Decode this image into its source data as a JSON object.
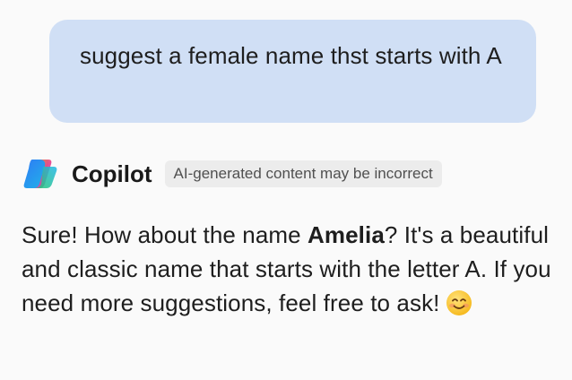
{
  "user_message": {
    "text": "suggest a female name thst starts with A"
  },
  "assistant": {
    "name": "Copilot",
    "disclaimer": "AI-generated content may be incorrect",
    "reply": {
      "part1": "Sure! How about the name ",
      "highlight": "Amelia",
      "part2": "? It's a beautiful and classic name that starts with the letter A. If you need more suggestions, feel free to ask!"
    },
    "emoji": "smiling-face-emoji"
  },
  "colors": {
    "user_bubble": "#d0dff5",
    "badge_bg": "#ececec",
    "background": "#fafafa"
  },
  "icons": {
    "logo": "copilot-logo-icon"
  }
}
